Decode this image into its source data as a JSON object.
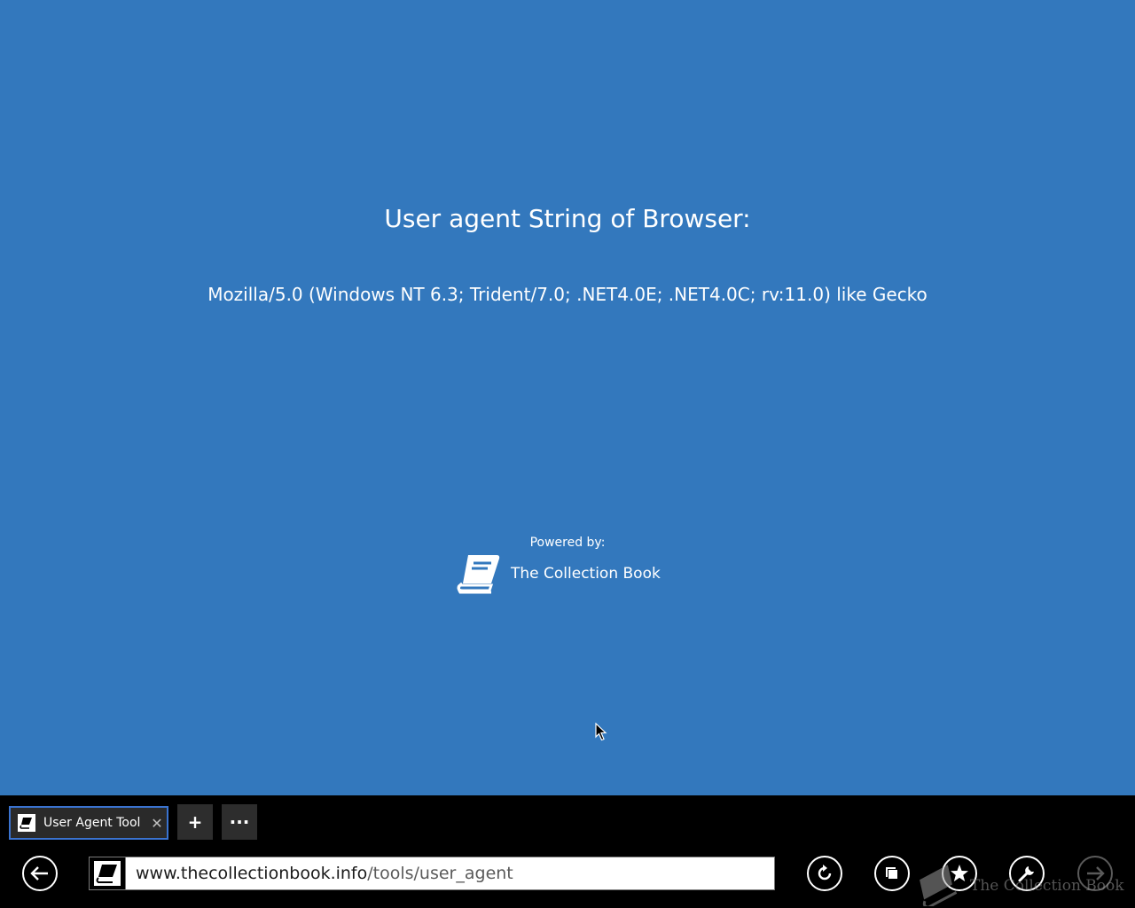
{
  "page": {
    "headline": "User agent String of Browser:",
    "user_agent": "Mozilla/5.0 (Windows NT 6.3; Trident/7.0; .NET4.0E; .NET4.0C; rv:11.0) like Gecko",
    "powered_by": "Powered by:",
    "brand_name": "The Collection Book"
  },
  "tabs": [
    {
      "title": "User Agent Tool",
      "close": "✕",
      "active": true
    }
  ],
  "tab_actions": {
    "new_tab": "+",
    "more": "···"
  },
  "address": {
    "domain": "www.thecollectionbook.info",
    "path": "/tools/user_agent"
  },
  "watermark": {
    "text": "The Collection Book"
  },
  "icons": {
    "back": "back-arrow-icon",
    "refresh": "refresh-icon",
    "tabs": "tabs-icon",
    "favorites": "star-icon",
    "tools": "wrench-icon",
    "forward": "forward-arrow-icon"
  },
  "colors": {
    "page_background": "#3378bd",
    "app_bar": "#000000",
    "tab_accent": "#3a73d0",
    "text": "#ffffff"
  }
}
